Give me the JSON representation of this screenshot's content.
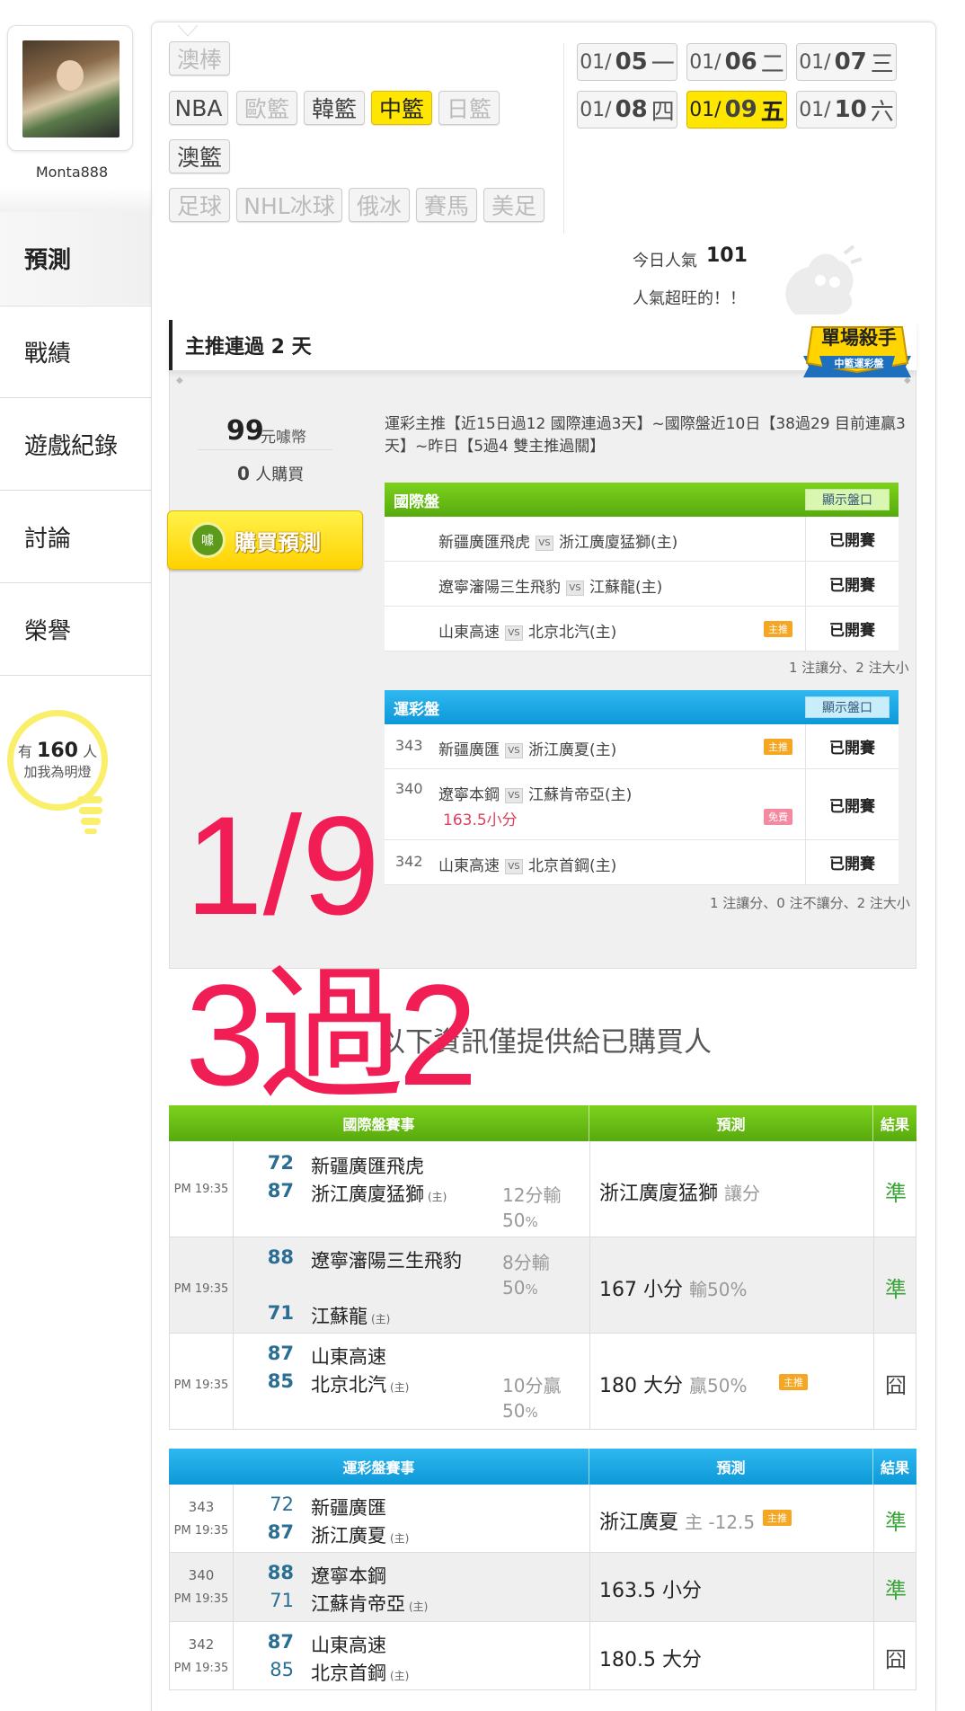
{
  "profile": {
    "username": "Monta888"
  },
  "nav": [
    {
      "label": "預測"
    },
    {
      "label": "戰績"
    },
    {
      "label": "遊戲紀錄"
    },
    {
      "label": "討論"
    },
    {
      "label": "榮譽"
    }
  ],
  "fans": {
    "prefix": "有",
    "count": "160",
    "suffix": "人",
    "line2": "加我為明燈"
  },
  "sports": [
    "澳棒",
    "NBA",
    "歐籃",
    "韓籃",
    "中籃",
    "日籃",
    "澳籃",
    "足球",
    "NHL冰球",
    "俄冰",
    "賽馬",
    "美足"
  ],
  "dates": [
    {
      "md": "01/",
      "d": "05",
      "w": "一"
    },
    {
      "md": "01/",
      "d": "06",
      "w": "二"
    },
    {
      "md": "01/",
      "d": "07",
      "w": "三"
    },
    {
      "md": "01/",
      "d": "08",
      "w": "四"
    },
    {
      "md": "01/",
      "d": "09",
      "w": "五"
    },
    {
      "md": "01/",
      "d": "10",
      "w": "六"
    }
  ],
  "popularity": {
    "label": "今日人氣",
    "count": "101",
    "text": "人氣超旺的！！"
  },
  "panel": {
    "title": "主推連過 2 天",
    "badge_line1": "單場殺手",
    "badge_line2": "中籃運彩盤",
    "price": "99",
    "price_unit": "元噱幣",
    "buyers": "0",
    "buyers_unit": "人購買",
    "buy_button": "購買預測",
    "buy_icon": "噱",
    "description": "運彩主推【近15日過12 國際連過3天】~國際盤近10日【38過29 目前連贏3天】~昨日【5過4 雙主推過關】",
    "intl": {
      "title": "國際盤",
      "show_btn": "顯示盤口",
      "rows": [
        {
          "home": "新疆廣匯飛虎",
          "vs": "VS",
          "away": "浙江廣廈猛獅(主)",
          "tag": "",
          "status": "已開賽"
        },
        {
          "home": "遼寧瀋陽三生飛豹",
          "vs": "VS",
          "away": "江蘇龍(主)",
          "tag": "",
          "status": "已開賽"
        },
        {
          "home": "山東高速",
          "vs": "VS",
          "away": "北京北汽(主)",
          "tag": "主推",
          "status": "已開賽"
        }
      ],
      "note": "1 注讓分、2 注大小"
    },
    "sport": {
      "title": "運彩盤",
      "show_btn": "顯示盤口",
      "rows": [
        {
          "num": "343",
          "home": "新疆廣匯",
          "vs": "VS",
          "away": "浙江廣夏(主)",
          "tag": "主推",
          "extra": "",
          "status": "已開賽"
        },
        {
          "num": "340",
          "home": "遼寧本鋼",
          "vs": "VS",
          "away": "江蘇肯帝亞(主)",
          "tag": "免費",
          "extra": "163.5小分",
          "status": "已開賽"
        },
        {
          "num": "342",
          "home": "山東高速",
          "vs": "VS",
          "away": "北京首鋼(主)",
          "tag": "",
          "extra": "",
          "status": "已開賽"
        }
      ],
      "note": "1 注讓分、0 注不讓分、2 注大小"
    }
  },
  "overlay": {
    "line1": "1/9",
    "line2": "3過2"
  },
  "info_text": "以下資訊僅提供給已購買人",
  "intl_table": {
    "headers": [
      "國際盤賽事",
      "預測",
      "結果"
    ],
    "rows": [
      {
        "time": "PM 19:35",
        "s1": "72",
        "t1": "新疆廣匯飛虎",
        "s2": "87",
        "t2": "浙江廣廈猛獅",
        "home": "(主)",
        "odds1": "12分輸",
        "odds2": "50",
        "pct": "%",
        "pred": "浙江廣廈猛獅",
        "pred_sub": "讓分",
        "tag": "",
        "result": "準"
      },
      {
        "time": "PM 19:35",
        "s1": "88",
        "t1": "遼寧瀋陽三生飛豹",
        "s2": "71",
        "t2": "江蘇龍",
        "home": "(主)",
        "odds1": "8分輸",
        "odds2": "50",
        "pct": "%",
        "pred": "167 小分",
        "pred_sub": "輸50%",
        "tag": "",
        "result": "準"
      },
      {
        "time": "PM 19:35",
        "s1": "87",
        "t1": "山東高速",
        "s2": "85",
        "t2": "北京北汽",
        "home": "(主)",
        "odds1": "10分贏",
        "odds2": "50",
        "pct": "%",
        "pred": "180 大分",
        "pred_sub": "贏50%",
        "tag": "主推",
        "result": "囧"
      }
    ]
  },
  "sport_table": {
    "headers": [
      "運彩盤賽事",
      "預測",
      "結果"
    ],
    "rows": [
      {
        "num": "343",
        "time": "PM 19:35",
        "s1": "72",
        "t1": "新疆廣匯",
        "s2": "87",
        "t2": "浙江廣夏",
        "home": "(主)",
        "pred": "浙江廣夏",
        "pred_sub": "主 -12.5",
        "tag": "主推",
        "result": "準"
      },
      {
        "num": "340",
        "time": "PM 19:35",
        "s1": "88",
        "t1": "遼寧本鋼",
        "s2": "71",
        "t2": "江蘇肯帝亞",
        "home": "(主)",
        "pred": "163.5 小分",
        "pred_sub": "",
        "tag": "",
        "result": "準"
      },
      {
        "num": "342",
        "time": "PM 19:35",
        "s1": "87",
        "t1": "山東高速",
        "s2": "85",
        "t2": "北京首鋼",
        "home": "(主)",
        "pred": "180.5 大分",
        "pred_sub": "",
        "tag": "",
        "result": "囧"
      }
    ]
  },
  "colors": {
    "accent": "#ffe600",
    "green": "#57aa0e",
    "blue": "#0d98d8",
    "overlay": "#f01e55",
    "win": "#3aa33a"
  }
}
